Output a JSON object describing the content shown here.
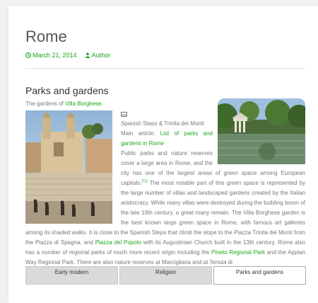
{
  "article": {
    "title": "Rome",
    "date": "March 21, 2014",
    "author": "Author"
  },
  "section": {
    "heading": "Parks and gardens",
    "subtitle_text": "The gardens of ",
    "subtitle_link": "Villa Borghese",
    "subtitle_end": ".",
    "caption": "Spanish Steps & Trinita dei Monti",
    "main_article_label": "Main article: ",
    "main_article_link": "List of parks and gardens in Rome",
    "p1": "Public parks and nature reserves cover a large area in Rome, and the city has one of the largest areas of green space among European capitals.",
    "ref": "[71]",
    "p2": " The most notable part of this green space is represented by the large number of villas and landscaped gardens created by the Italian aristocracy. While many villas were destroyed during the building boom of the late 19th century, a great many remain. The Villa Borghese garden is the best known large green space in Rome, with famous art galleries among its shaded walks. It is close to the Spanish Steps that climb the slope to the Piazza Trinita dei Monti from the Piazza di Spagna, and ",
    "link_popolo": "Piazza del Popolo",
    "p3": " with its Augustinian Church built in the 13th century. Rome also has a number of regional parks of much more recent origin including the ",
    "link_pineto": "Pineto Regional Park",
    "p4": " and the Appian Way Regional Park. There are also nature reserves at Marcigliana and at Tenuta di"
  },
  "tabs": [
    {
      "label": "Early modern",
      "active": false
    },
    {
      "label": "Religion",
      "active": false
    },
    {
      "label": "Parks and gardens",
      "active": true
    }
  ],
  "colors": {
    "link": "#1aa51a",
    "background": "#f1f1f1",
    "card": "#ffffff"
  },
  "icons": {
    "date": "clock-icon",
    "author": "user-icon",
    "caption": "image-icon"
  }
}
